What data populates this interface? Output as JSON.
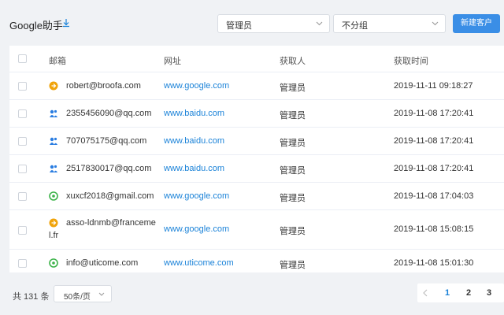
{
  "header": {
    "title": "Google助手",
    "download_icon": "download-icon",
    "source_select": {
      "value": "管理员"
    },
    "group_select": {
      "value": "不分组"
    },
    "new_button": "新建客户"
  },
  "table": {
    "columns": [
      "邮箱",
      "网址",
      "获取人",
      "获取时间"
    ],
    "rows": [
      {
        "icon": "google-source-icon",
        "icon_color": "#f0a30a",
        "email": "robert@broofa.com",
        "site": "www.google.com",
        "owner": "管理员",
        "time": "2019-11-11 09:18:27"
      },
      {
        "icon": "baidu-source-icon",
        "icon_color": "#2a7de1",
        "email": "2355456090@qq.com",
        "site": "www.baidu.com",
        "owner": "管理员",
        "time": "2019-11-08 17:20:41"
      },
      {
        "icon": "baidu-source-icon",
        "icon_color": "#2a7de1",
        "email": "707075175@qq.com",
        "site": "www.baidu.com",
        "owner": "管理员",
        "time": "2019-11-08 17:20:41"
      },
      {
        "icon": "baidu-source-icon",
        "icon_color": "#2a7de1",
        "email": "2517830017@qq.com",
        "site": "www.baidu.com",
        "owner": "管理员",
        "time": "2019-11-08 17:20:41"
      },
      {
        "icon": "website-source-icon",
        "icon_color": "#3db34a",
        "email": "xuxcf2018@gmail.com",
        "site": "www.google.com",
        "owner": "管理员",
        "time": "2019-11-08 17:04:03"
      },
      {
        "icon": "google-source-icon",
        "icon_color": "#f0a30a",
        "email_line1": "asso-ldnmb@franceme",
        "email_line2": "l.fr",
        "site": "www.google.com",
        "owner": "管理员",
        "time": "2019-11-08 15:08:15"
      },
      {
        "icon": "website-source-icon",
        "icon_color": "#3db34a",
        "email": "info@uticome.com",
        "site": "www.uticome.com",
        "owner": "管理员",
        "time": "2019-11-08 15:01:30"
      }
    ]
  },
  "footer": {
    "total": "共 131 条",
    "page_size": "50条/页",
    "pages": [
      "1",
      "2",
      "3"
    ],
    "active_page": "1"
  },
  "colors": {
    "accent": "#3a8ee6",
    "link": "#1a82d8",
    "background": "#f0f2f5"
  }
}
